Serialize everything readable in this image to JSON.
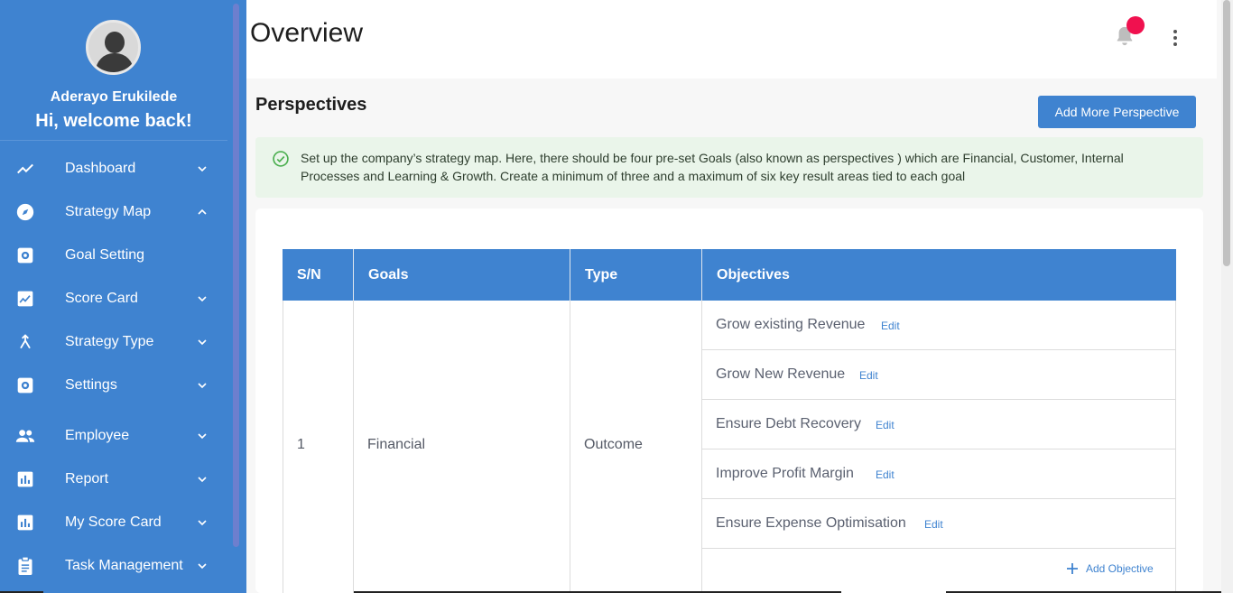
{
  "sidebar": {
    "user_name": "Aderayo Erukilede",
    "welcome": "Hi, welcome back!",
    "items": [
      {
        "label": "Dashboard",
        "icon": "trending-icon",
        "chevron": "down"
      },
      {
        "label": "Strategy Map",
        "icon": "compass-icon",
        "chevron": "up"
      },
      {
        "label": "Goal Setting",
        "icon": "gear-box-icon",
        "chevron": ""
      },
      {
        "label": "Score Card",
        "icon": "chart-box-icon",
        "chevron": "down"
      },
      {
        "label": "Strategy Type",
        "icon": "merge-icon",
        "chevron": "down"
      },
      {
        "label": "Settings",
        "icon": "gear-box-icon",
        "chevron": "down"
      },
      {
        "label": "Employee",
        "icon": "people-icon",
        "chevron": "down"
      },
      {
        "label": "Report",
        "icon": "bar-chart-icon",
        "chevron": "down"
      },
      {
        "label": "My Score Card",
        "icon": "bar-chart-icon",
        "chevron": "down"
      },
      {
        "label": "Task Management",
        "icon": "clipboard-icon",
        "chevron": "down"
      }
    ]
  },
  "header": {
    "title": "Overview"
  },
  "main": {
    "section_title": "Perspectives",
    "add_button": "Add More Perspective",
    "alert_text": "Set up the company’s strategy map. Here, there should be four pre-set Goals (also known as perspectives ) which are Financial, Customer, Internal Processes and Learning & Growth. Create a minimum of three and a maximum of six key result areas tied to each goal",
    "table": {
      "headers": [
        "S/N",
        "Goals",
        "Type",
        "Objectives"
      ],
      "rows": [
        {
          "sn": "1",
          "goal": "Financial",
          "type": "Outcome",
          "objectives": [
            "Grow existing Revenue",
            "Grow New Revenue",
            "Ensure Debt Recovery",
            "Improve Profit Margin",
            "Ensure Expense Optimisation"
          ]
        }
      ],
      "edit_label": "Edit",
      "add_objective_label": "Add Objective"
    }
  },
  "colors": {
    "primary": "#3f83d0",
    "notification": "#f0114f",
    "alert_bg": "#eaf5ea"
  }
}
